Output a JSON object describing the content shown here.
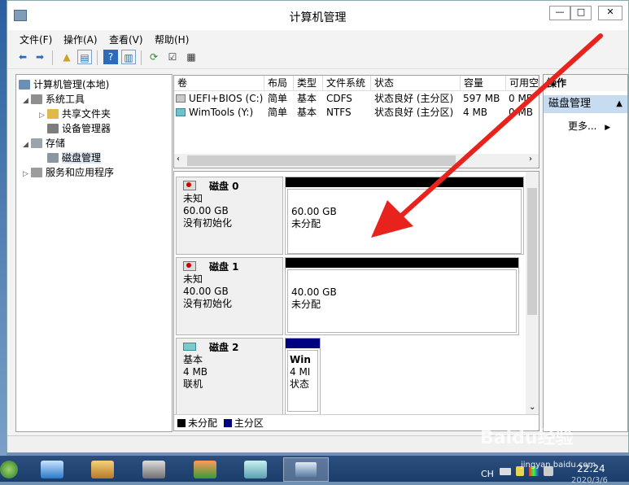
{
  "window": {
    "title": "计算机管理",
    "controls": {
      "minimize": "—",
      "maximize": "□",
      "close": "✕"
    }
  },
  "menu": [
    "文件(F)",
    "操作(A)",
    "查看(V)",
    "帮助(H)"
  ],
  "tree": {
    "root": "计算机管理(本地)",
    "system_tools": "系统工具",
    "shared_folders": "共享文件夹",
    "device_manager": "设备管理器",
    "storage": "存储",
    "disk_management": "磁盘管理",
    "services_apps": "服务和应用程序"
  },
  "volume_list": {
    "columns": [
      "卷",
      "布局",
      "类型",
      "文件系统",
      "状态",
      "容量",
      "可用空"
    ],
    "rows": [
      [
        "UEFI+BIOS (C:)",
        "简单",
        "基本",
        "CDFS",
        "状态良好 (主分区)",
        "597 MB",
        "0 MB"
      ],
      [
        "WimTools (Y:)",
        "简单",
        "基本",
        "NTFS",
        "状态良好 (主分区)",
        "4 MB",
        "0 MB"
      ]
    ]
  },
  "disks": [
    {
      "name": "磁盘 0",
      "kind": "未知",
      "size": "60.00 GB",
      "status": "没有初始化",
      "partition_size": "60.00 GB",
      "partition_status": "未分配"
    },
    {
      "name": "磁盘 1",
      "kind": "未知",
      "size": "40.00 GB",
      "status": "没有初始化",
      "partition_size": "40.00 GB",
      "partition_status": "未分配"
    },
    {
      "name": "磁盘 2",
      "kind": "基本",
      "size": "4 MB",
      "status": "联机",
      "partition_size": "Win",
      "partition_status": "4 MI",
      "partition_extra": "状态"
    }
  ],
  "legend": {
    "unallocated": "未分配",
    "primary": "主分区"
  },
  "actions": {
    "header": "操作",
    "selected": "磁盘管理",
    "more": "更多..."
  },
  "tray": {
    "lang": "CH",
    "time": "22:24",
    "date": "2020/3/6"
  },
  "watermark": {
    "brand": "Baidu经验",
    "site": "jingyan.baidu.com"
  },
  "colors": {
    "annotation_arrow": "#e8231d",
    "primary_partition": "#000080",
    "unallocated": "#000000"
  }
}
